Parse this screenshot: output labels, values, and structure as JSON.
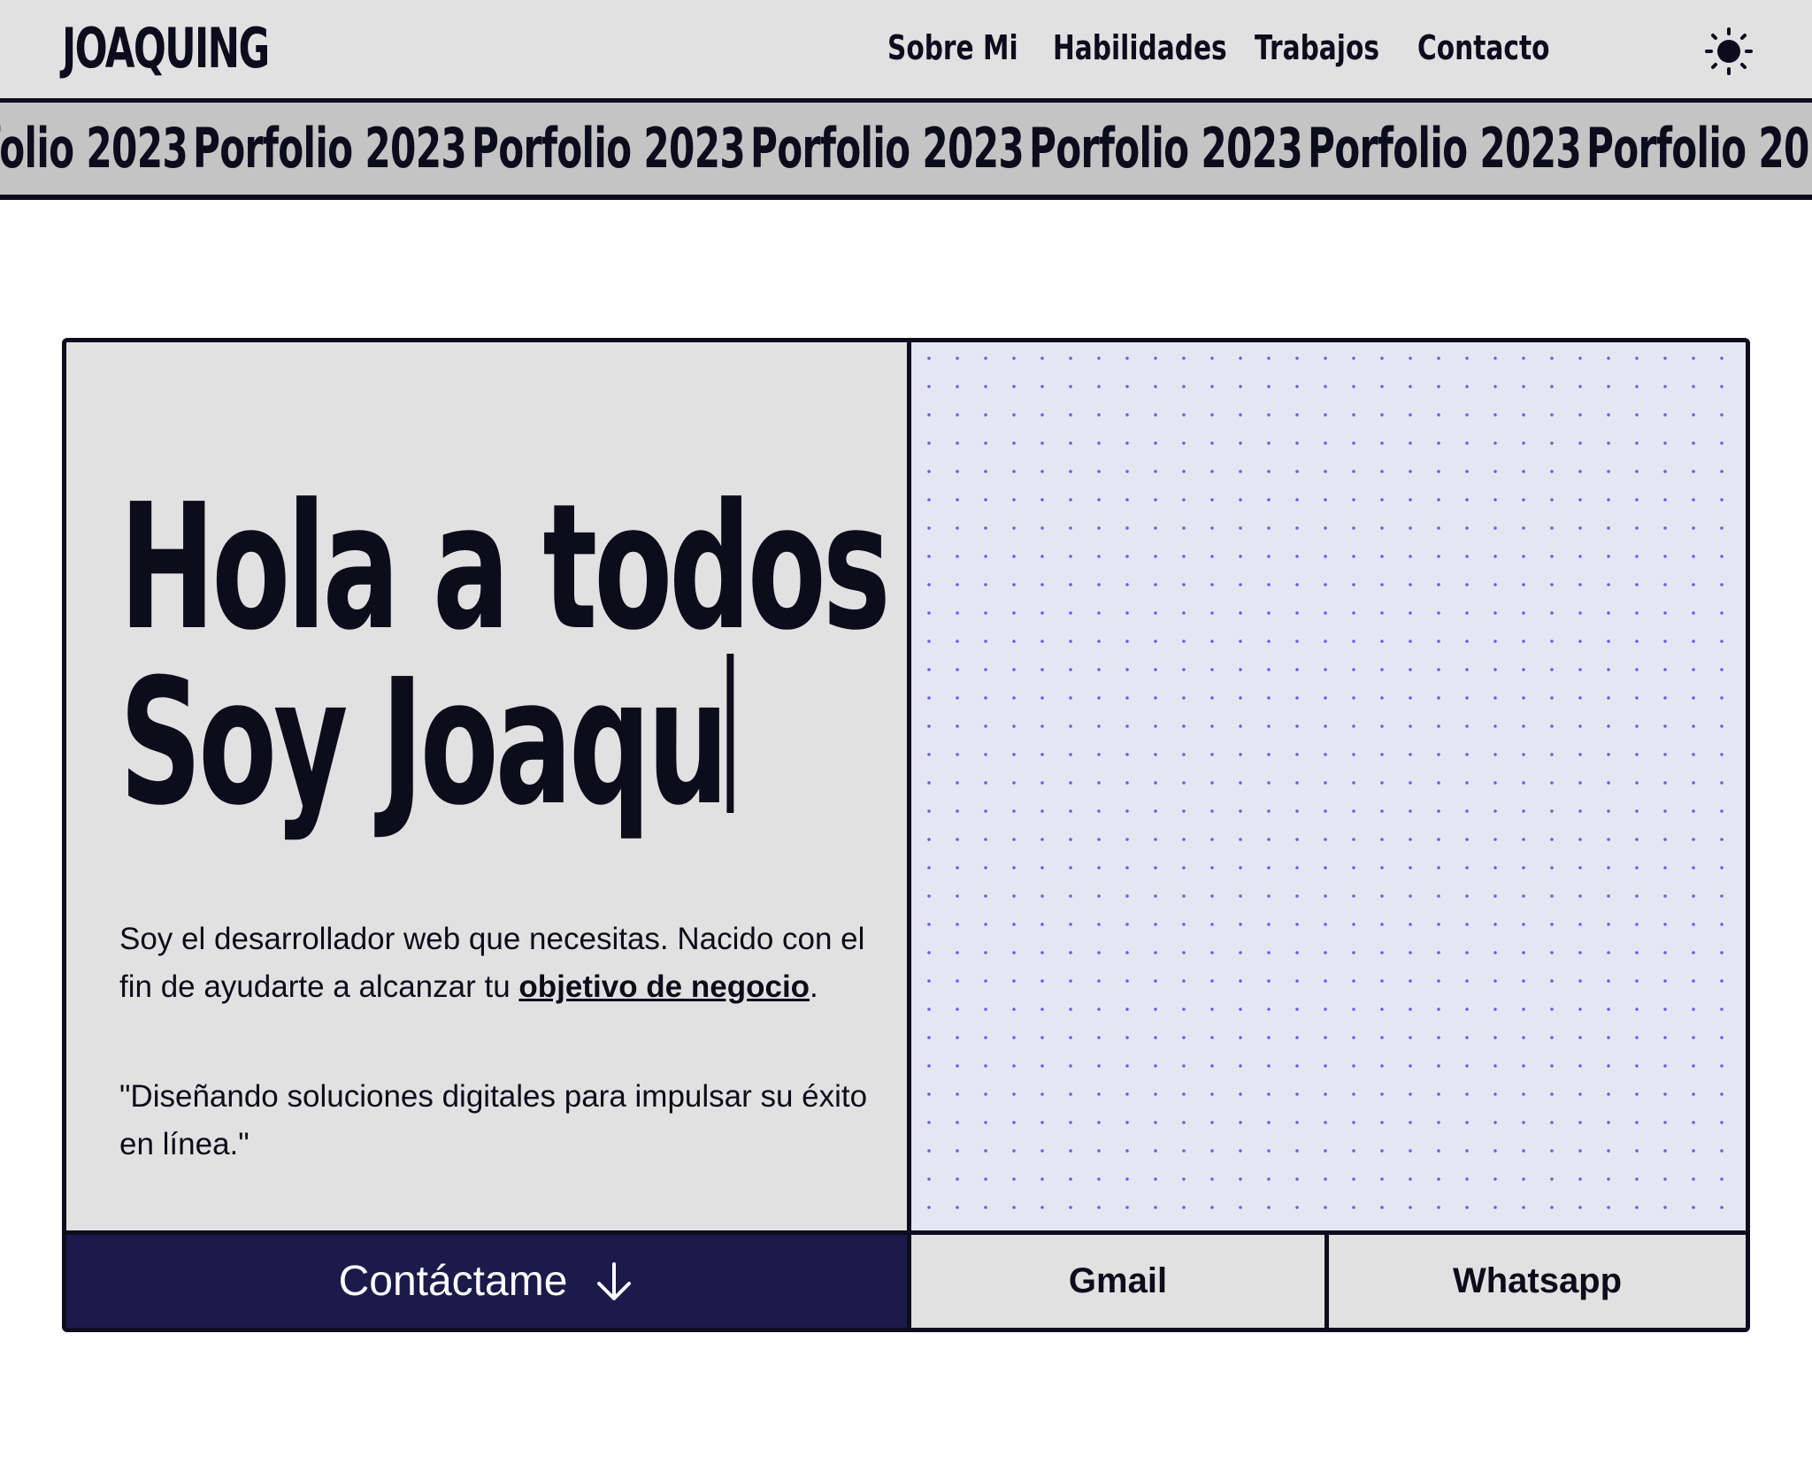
{
  "header": {
    "logo": "JOAQUING",
    "nav": [
      {
        "label": "Sobre Mi"
      },
      {
        "label": "Habilidades"
      },
      {
        "label": "Trabajos"
      },
      {
        "label": "Contacto"
      }
    ],
    "theme_icon": "sun-icon"
  },
  "marquee": {
    "items": [
      "Porfolio 2023",
      "Porfolio 2023",
      "Porfolio 2023",
      "Porfolio 2023",
      "Porfolio 2023",
      "Porfolio 2023",
      "Porfolio 2023"
    ]
  },
  "hero": {
    "headline_line1": "Hola a todos",
    "headline_line2": "Soy Joaqu",
    "intro_text": "Soy el desarrollador web que necesitas. Nacido con el fin de ayudarte a alcanzar tu ",
    "intro_link": "objetivo de negocio",
    "intro_end": ".",
    "quote": "\"Diseñando soluciones digitales para impulsar su éxito en línea.\""
  },
  "actions": {
    "contact_label": "Contáctame",
    "contact_icon": "arrow-down-icon",
    "gmail_label": "Gmail",
    "whatsapp_label": "Whatsapp"
  },
  "colors": {
    "ink": "#0d0c1d",
    "header_bg": "#e1e1e1",
    "marquee_bg": "#c4c4c4",
    "pattern_bg": "#e6e6f2",
    "dot": "#6b5cf0",
    "contact_bg": "#1b1a4a"
  }
}
